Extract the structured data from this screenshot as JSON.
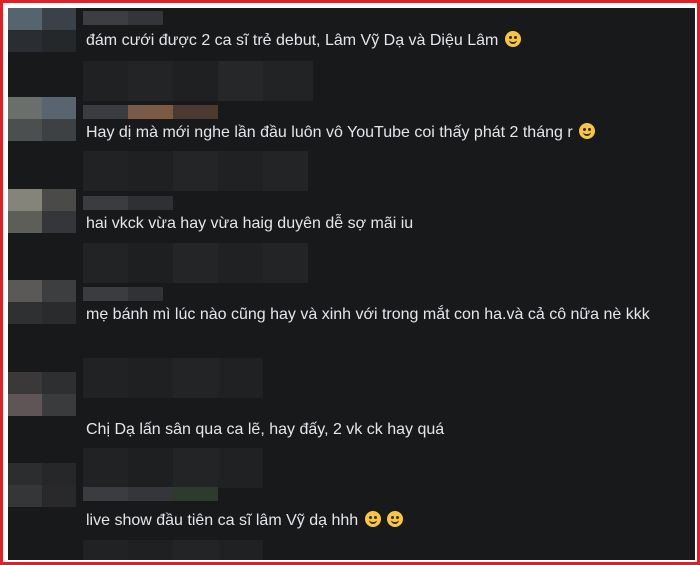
{
  "comments": [
    {
      "text": "đám cưới được 2 ca sĩ trẻ debut, Lâm Vỹ Dạ và Diệu Lâm",
      "emoji": [
        "grinning-sweat-emoji"
      ]
    },
    {
      "text": "Hay dị mà mới nghe lần đầu luôn vô YouTube coi thấy phát 2 tháng r",
      "emoji": [
        "flushed-emoji"
      ]
    },
    {
      "text": "hai vkck vừa hay vừa haig duyên dễ sợ mãi iu",
      "emoji": []
    },
    {
      "text": "mẹ bánh mì lúc nào cũng hay và xinh với trong mắt con ha.và cả cô nữa nè kkk",
      "emoji": []
    },
    {
      "text": "Chị Dạ lấn sân qua ca lẽ, hay đấy, 2 vk ck hay quá",
      "emoji": []
    },
    {
      "text": "live show đầu tiên ca sĩ lâm Vỹ dạ hhh",
      "emoji": [
        "laughing-emoji",
        "laughing-emoji"
      ]
    }
  ],
  "colors": {
    "frame_border": "#e41e26",
    "panel_bg": "#18191a",
    "text": "#e4e6eb"
  }
}
